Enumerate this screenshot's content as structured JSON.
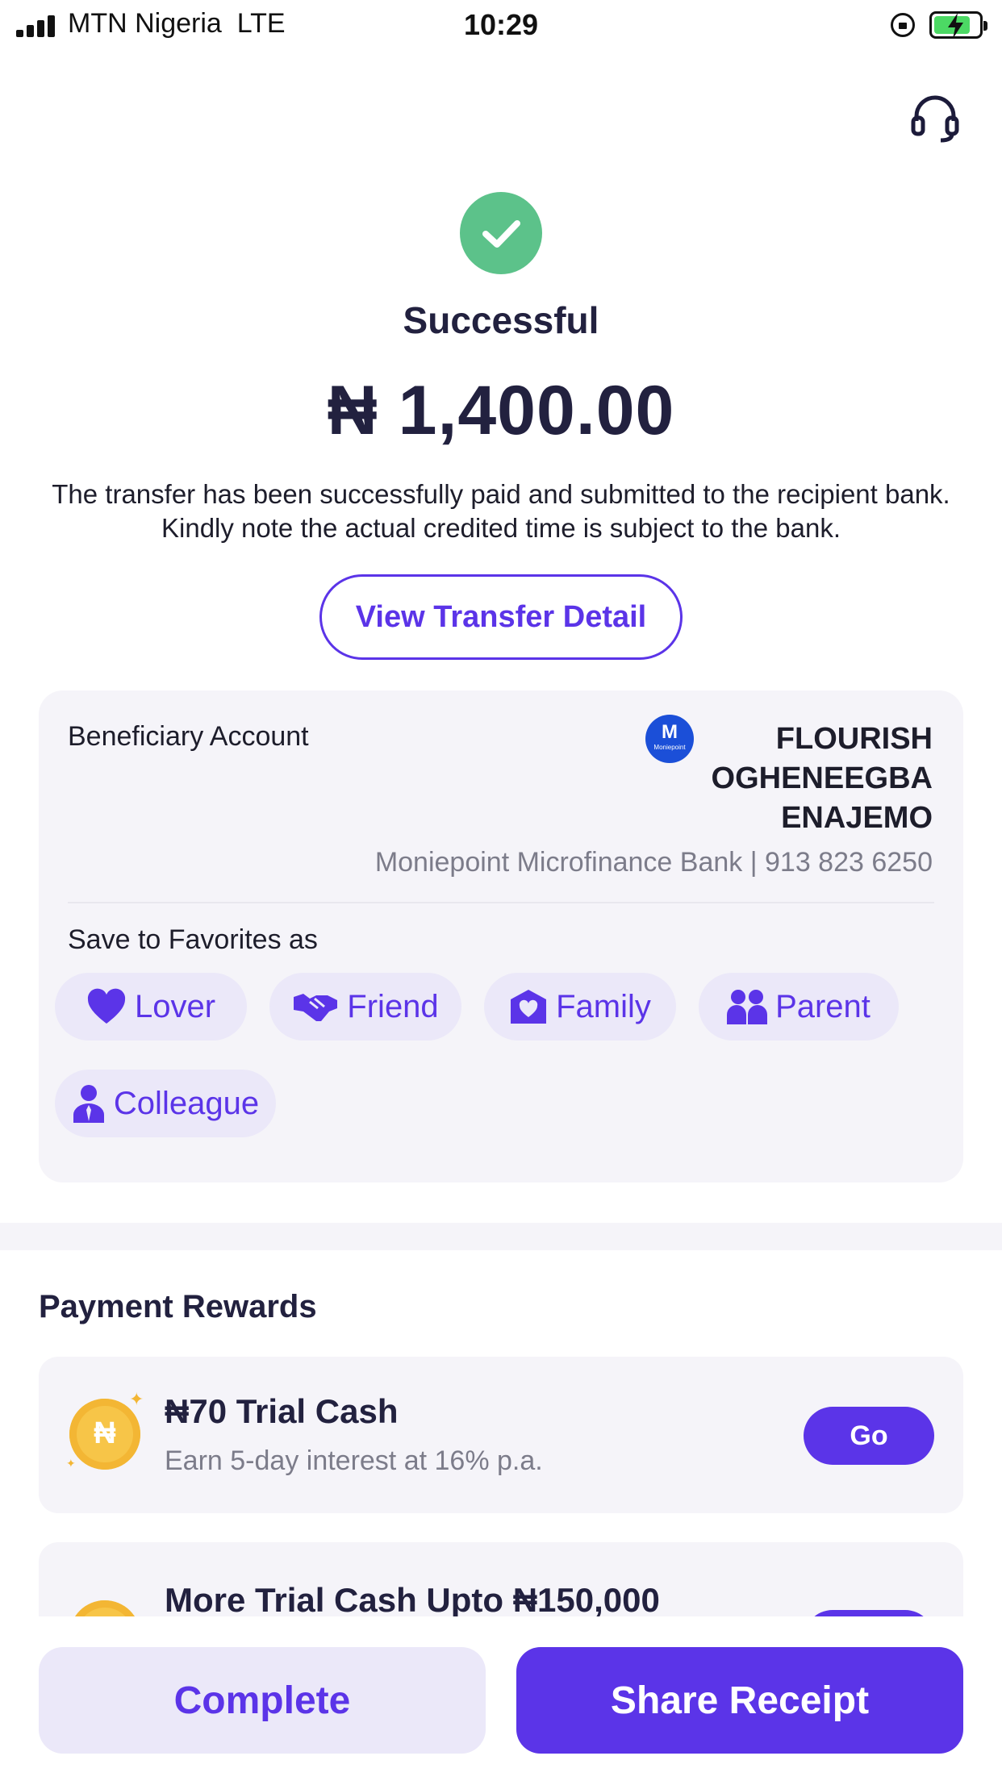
{
  "status_bar": {
    "carrier": "MTN Nigeria",
    "network": "LTE",
    "time": "10:29",
    "battery_state": "charging"
  },
  "result": {
    "title": "Successful",
    "amount": "₦ 1,400.00",
    "description": "The transfer has been successfully paid and submitted to the recipient bank. Kindly note the actual credited time is subject to the bank.",
    "view_detail_label": "View Transfer Detail"
  },
  "beneficiary": {
    "label": "Beneficiary Account",
    "bank_logo_letter": "M",
    "bank_logo_text": "Moniepoint",
    "name_lines": [
      "FLOURISH",
      "OGHENEEGBA",
      "ENAJEMO"
    ],
    "bank_account": "Moniepoint Microfinance Bank | 913 823 6250"
  },
  "favorites": {
    "label": "Save to Favorites as",
    "options": [
      {
        "label": "Lover",
        "icon": "heart-icon"
      },
      {
        "label": "Friend",
        "icon": "handshake-icon"
      },
      {
        "label": "Family",
        "icon": "home-heart-icon"
      },
      {
        "label": "Parent",
        "icon": "people-icon"
      },
      {
        "label": "Colleague",
        "icon": "person-tie-icon"
      }
    ]
  },
  "rewards": {
    "heading": "Payment Rewards",
    "items": [
      {
        "title": "₦70 Trial Cash",
        "subtitle": "Earn 5-day interest at 16% p.a.",
        "button": "Go",
        "icon": "naira-coin-icon"
      },
      {
        "title": "More Trial Cash Upto ₦150,000",
        "icon": "naira-coin-icon"
      }
    ]
  },
  "footer": {
    "complete_label": "Complete",
    "share_label": "Share Receipt"
  },
  "colors": {
    "primary": "#5b34e8",
    "success": "#5cc28a",
    "card_bg": "#f5f4f9",
    "chip_bg": "#ebe8f9",
    "coin": "#f7c548"
  }
}
